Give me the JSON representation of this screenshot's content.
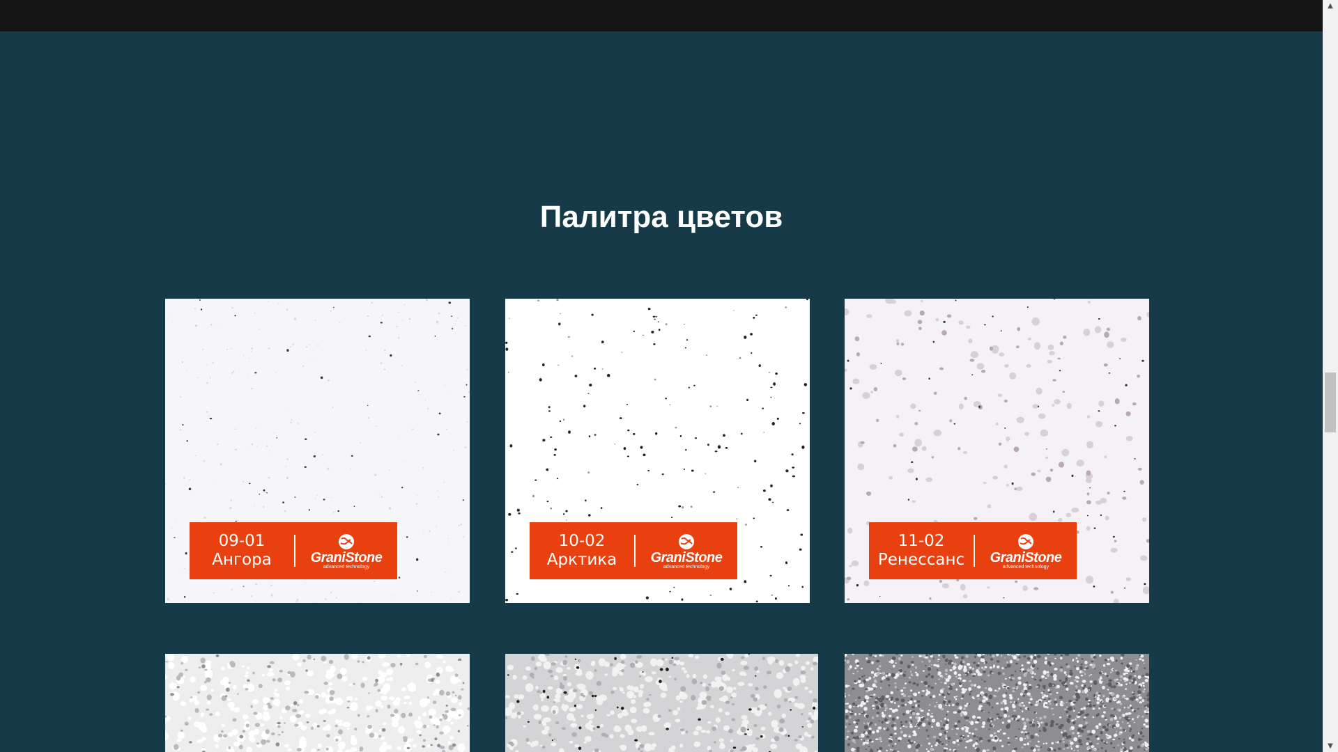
{
  "section": {
    "title": "Палитра цветов"
  },
  "colors": {
    "topbar": "#141414",
    "background": "#163a47",
    "label": "#e8400f",
    "title_text": "#ffffff"
  },
  "palette": [
    {
      "code": "09-01",
      "name": "Ангора",
      "brand": "GraniStone",
      "brand_sub": "advanced technology"
    },
    {
      "code": "10-02",
      "name": "Арктика",
      "brand": "GraniStone",
      "brand_sub": "advanced technology"
    },
    {
      "code": "11-02",
      "name": "Ренессанс",
      "brand": "GraniStone",
      "brand_sub": "advanced technology"
    }
  ],
  "scrollbar": {
    "up_icon": "arrow-up-icon",
    "down_icon": "arrow-down-icon",
    "up_glyph": "▲",
    "down_glyph": "▼"
  }
}
